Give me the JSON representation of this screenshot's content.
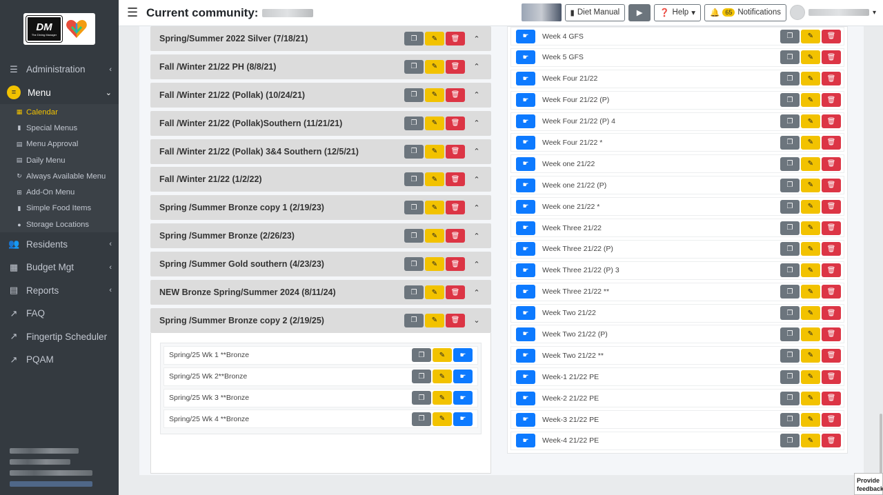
{
  "header": {
    "title": "Current community:",
    "diet_manual": "Diet Manual",
    "help": "Help",
    "notification_count": "65",
    "notifications": "Notifications"
  },
  "sidebar": {
    "logo_text": "DM",
    "logo_subtext": "The Dining Manager",
    "items": [
      {
        "label": "Administration",
        "icon": "sliders-icon"
      },
      {
        "label": "Menu",
        "icon": "menu-icon"
      },
      {
        "label": "Residents",
        "icon": "users-icon"
      },
      {
        "label": "Budget Mgt",
        "icon": "table-icon"
      },
      {
        "label": "Reports",
        "icon": "book-icon"
      },
      {
        "label": "FAQ",
        "icon": "external-link-icon"
      },
      {
        "label": "Fingertip Scheduler",
        "icon": "external-link-icon"
      },
      {
        "label": "PQAM",
        "icon": "external-link-icon"
      }
    ],
    "menu_sub": [
      {
        "label": "Calendar"
      },
      {
        "label": "Special Menus"
      },
      {
        "label": "Menu Approval"
      },
      {
        "label": "Daily Menu"
      },
      {
        "label": "Always Available Menu"
      },
      {
        "label": "Add-On Menu"
      },
      {
        "label": "Simple Food Items"
      },
      {
        "label": "Storage Locations"
      }
    ]
  },
  "left_menus": [
    {
      "name": "Spring/Summer 2022 Silver (7/18/21)"
    },
    {
      "name": "Fall /Winter 21/22 PH (8/8/21)"
    },
    {
      "name": "Fall /Winter 21/22 (Pollak) (10/24/21)"
    },
    {
      "name": "Fall /Winter 21/22 (Pollak)Southern (11/21/21)"
    },
    {
      "name": "Fall /Winter 21/22 (Pollak) 3&4 Southern (12/5/21)"
    },
    {
      "name": "Fall /Winter 21/22 (1/2/22)"
    },
    {
      "name": "Spring /Summer Bronze copy 1 (2/19/23)"
    },
    {
      "name": "Spring /Summer Bronze (2/26/23)"
    },
    {
      "name": "Spring /Summer Gold southern (4/23/23)"
    },
    {
      "name": "NEW Bronze Spring/Summer 2024 (8/11/24)"
    },
    {
      "name": "Spring /Summer Bronze copy 2 (2/19/25)"
    }
  ],
  "expanded_weeks": [
    {
      "name": "Spring/25 Wk 1 **Bronze"
    },
    {
      "name": "Spring/25 Wk 2**Bronze"
    },
    {
      "name": "Spring/25 Wk 3 **Bronze"
    },
    {
      "name": "Spring/25 Wk 4 **Bronze"
    }
  ],
  "right_weeks": [
    {
      "name": "Week 4 GFS"
    },
    {
      "name": "Week 5 GFS"
    },
    {
      "name": "Week Four 21/22"
    },
    {
      "name": "Week Four 21/22 (P)"
    },
    {
      "name": "Week Four 21/22 (P) 4"
    },
    {
      "name": "Week Four 21/22 *"
    },
    {
      "name": "Week one 21/22"
    },
    {
      "name": "Week one 21/22 (P)"
    },
    {
      "name": "Week one 21/22 *"
    },
    {
      "name": "Week Three 21/22"
    },
    {
      "name": "Week Three 21/22 (P)"
    },
    {
      "name": "Week Three 21/22 (P) 3"
    },
    {
      "name": "Week Three 21/22 **"
    },
    {
      "name": "Week Two 21/22"
    },
    {
      "name": "Week Two 21/22 (P)"
    },
    {
      "name": "Week Two 21/22 **"
    },
    {
      "name": "Week-1 21/22 PE"
    },
    {
      "name": "Week-2 21/22 PE"
    },
    {
      "name": "Week-3 21/22 PE"
    },
    {
      "name": "Week-4 21/22 PE"
    }
  ],
  "feedback": {
    "line1": "Provide",
    "line2": "feedback"
  },
  "colors": {
    "sidebar_bg": "#343a40",
    "accent_yellow": "#f2c200",
    "btn_gray": "#6c757d",
    "btn_red": "#dc3545",
    "btn_blue": "#0d7aff"
  }
}
